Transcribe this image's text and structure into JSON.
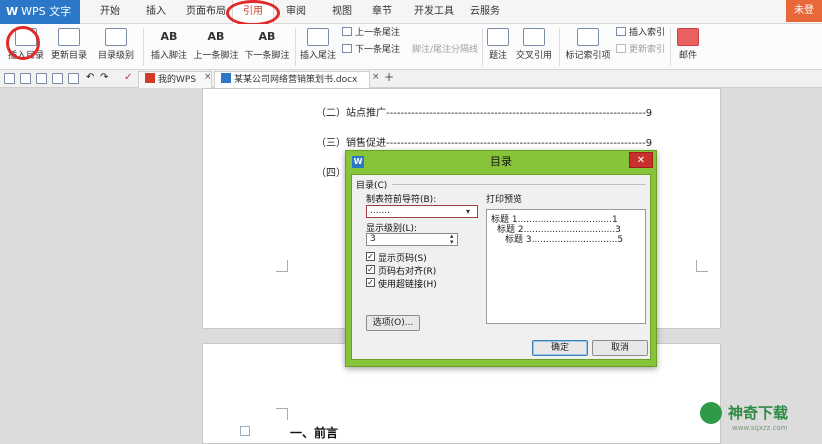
{
  "app": {
    "logo": "WPS 文字",
    "logo_mark": "W"
  },
  "menu_tabs": [
    {
      "label": "开始"
    },
    {
      "label": "插入"
    },
    {
      "label": "页面布局"
    },
    {
      "label": "引用",
      "active": true
    },
    {
      "label": "审阅"
    },
    {
      "label": "视图"
    },
    {
      "label": "章节"
    },
    {
      "label": "开发工具"
    },
    {
      "label": "云服务"
    }
  ],
  "login_label": "未登",
  "ribbon": {
    "insert_toc": "插入目录",
    "update_toc": "更新目录",
    "toc_level": "目录级别",
    "insert_footnote": "插入脚注",
    "prev_footnote": "上一条脚注",
    "next_footnote": "下一条脚注",
    "insert_endnote": "插入尾注",
    "prev_endnote": "上一条尾注",
    "next_endnote": "下一条尾注",
    "footnote_separator": "脚注/尾注分隔线",
    "caption": "题注",
    "cross_ref": "交叉引用",
    "mark_index": "标记索引项",
    "insert_index": "插入索引",
    "update_index": "更新索引",
    "mail": "邮件"
  },
  "doc_tabs": [
    {
      "label": "我的WPS",
      "active": false
    },
    {
      "label": "某某公司网络营销策划书.docx *",
      "active": true
    }
  ],
  "new_tab_symbol": "+",
  "document": {
    "toc_lines": [
      {
        "text": "（二）站点推广------------------------------------------------------------------------9"
      },
      {
        "text": "（三）销售促进------------------------------------------------------------------------9"
      },
      {
        "text": "（四）口------------------------------------------------------------------------------9"
      }
    ],
    "heading": "一、前言"
  },
  "dialog": {
    "title": "目录",
    "icon": "W",
    "close": "✕",
    "group_label": "目录(C)",
    "leader_label": "制表符前导符(B):",
    "leader_value": ".......",
    "level_label": "显示级别(L):",
    "level_value": "3",
    "show_page_numbers": {
      "label": "显示页码(S)",
      "checked": true
    },
    "right_align": {
      "label": "页码右对齐(R)",
      "checked": true
    },
    "use_hyperlinks": {
      "label": "使用超链接(H)",
      "checked": true
    },
    "options_button": "选项(O)...",
    "preview_label": "打印预览",
    "preview_lines": [
      {
        "text": "标题 1.................................1"
      },
      {
        "text": "标题 2................................3"
      },
      {
        "text": "标题 3..............................5"
      }
    ],
    "ok": "确定",
    "cancel": "取消"
  },
  "watermark": {
    "text": "神奇下载",
    "url": "www.sqxzz.com"
  },
  "colors": {
    "accent": "#2b78c8",
    "active_tab": "#d03b2a",
    "dialog_frame": "#88c43a",
    "annotation": "#e02a2a"
  }
}
